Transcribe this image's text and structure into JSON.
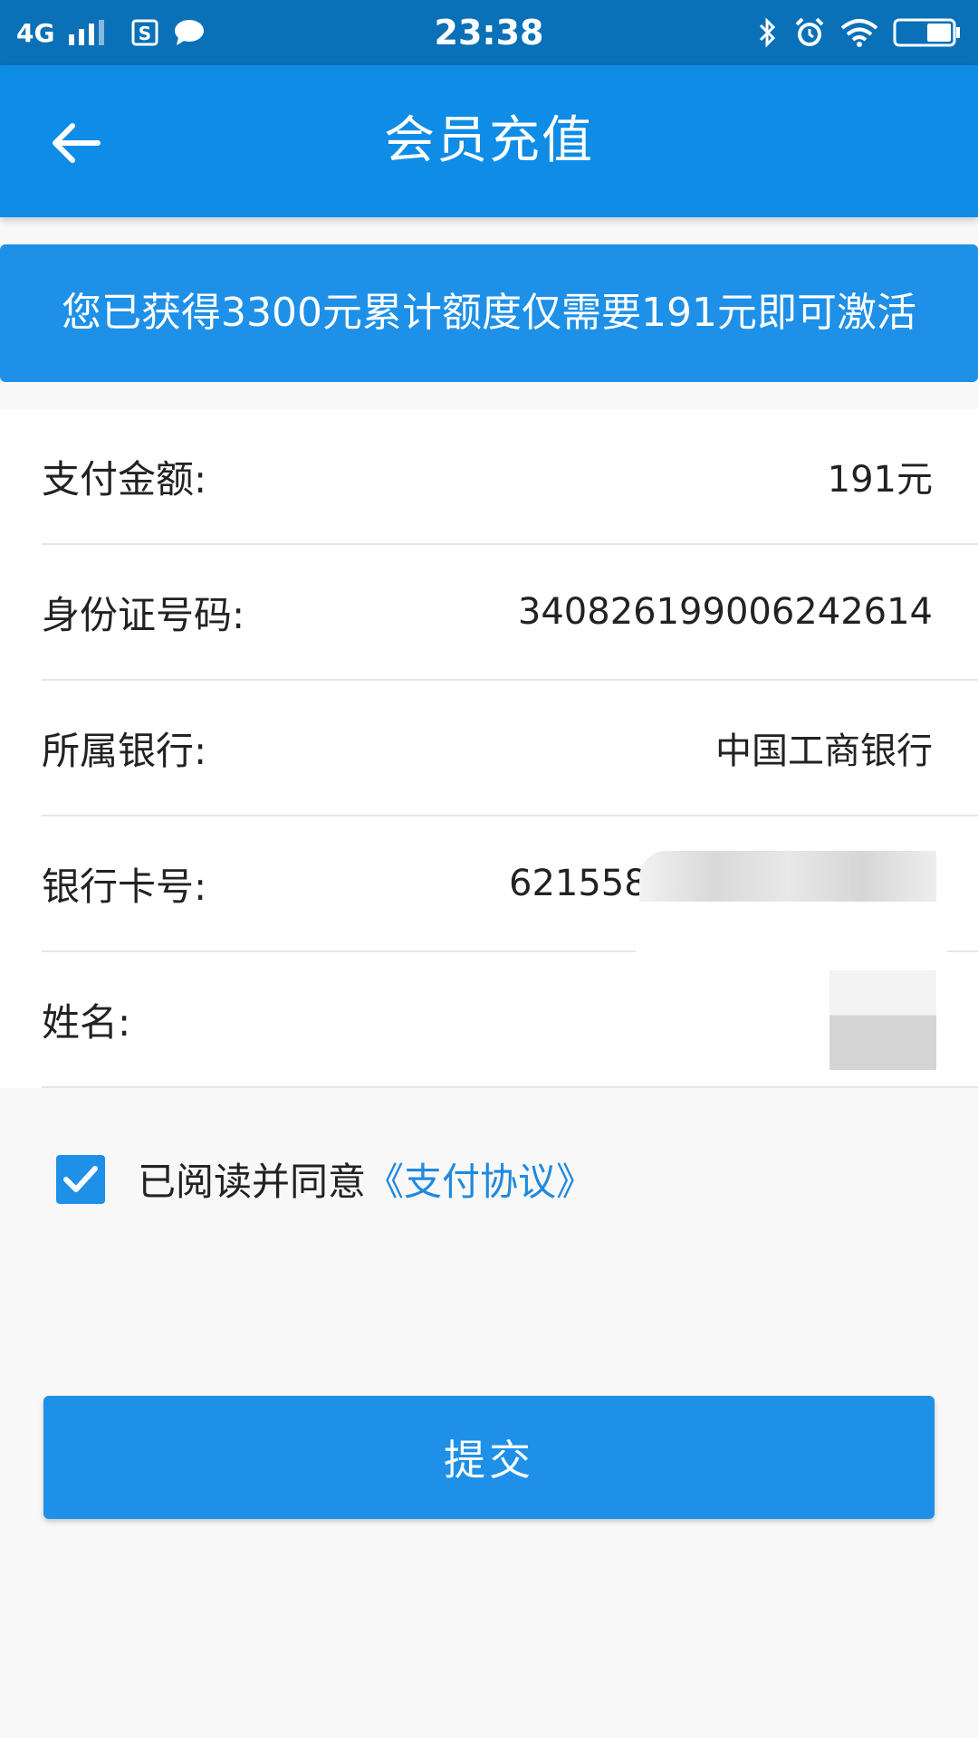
{
  "status_bar": {
    "network": "4G",
    "time": "23:38",
    "icons": [
      "signal-icon",
      "sim-app-icon",
      "message-icon",
      "bluetooth-icon",
      "alarm-icon",
      "wifi-icon",
      "battery-icon"
    ]
  },
  "header": {
    "title": "会员充值",
    "back_icon": "arrow-left-icon"
  },
  "banner": {
    "text": "您已获得3300元累计额度仅需要191元即可激活"
  },
  "form": {
    "rows": [
      {
        "label": "支付金额:",
        "value": "191元"
      },
      {
        "label": "身份证号码:",
        "value": "340826199006242614"
      },
      {
        "label": "所属银行:",
        "value": "中国工商银行"
      },
      {
        "label": "银行卡号:",
        "value": "6215581"
      },
      {
        "label": "姓名:",
        "value": ""
      }
    ]
  },
  "agreement": {
    "checked": true,
    "text": "已阅读并同意",
    "link": "《支付协议》"
  },
  "submit": {
    "label": "提交"
  },
  "colors": {
    "status_bar": "#0a70b8",
    "header": "#0f8ce6",
    "accent": "#1e90e8",
    "link": "#2189dd"
  }
}
